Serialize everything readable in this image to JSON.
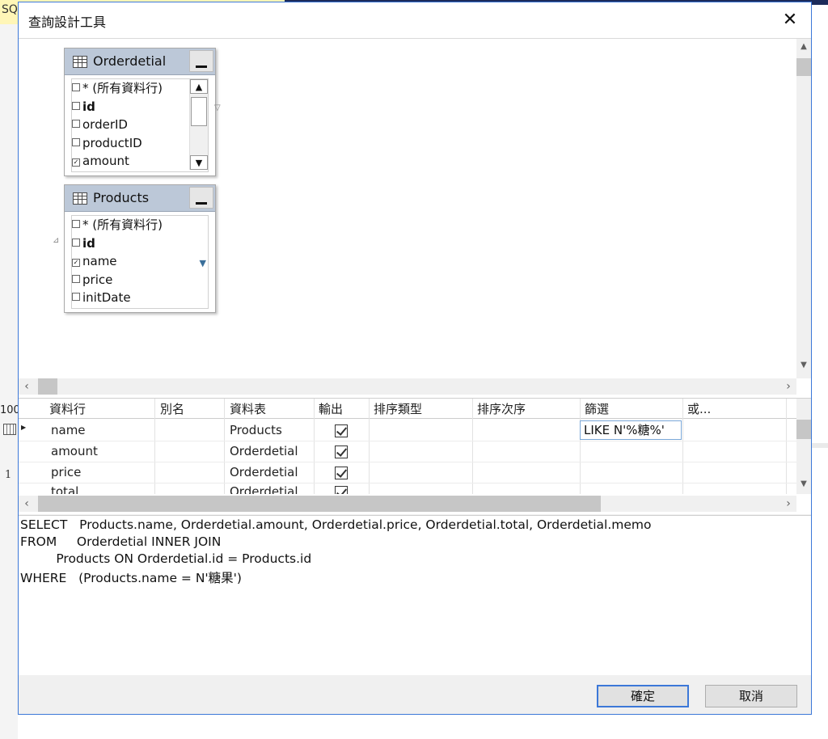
{
  "background": {
    "tab_fragment": "SQ",
    "zoom_fragment": "100",
    "line_number": "1"
  },
  "dialog": {
    "title": "查詢設計工具",
    "close_glyph": "✕"
  },
  "tables": [
    {
      "name": "Orderdetial",
      "columns": [
        {
          "label": "* (所有資料行)",
          "checked": false,
          "bold": false
        },
        {
          "label": "id",
          "checked": false,
          "bold": true
        },
        {
          "label": "orderID",
          "checked": false,
          "bold": false
        },
        {
          "label": "productID",
          "checked": false,
          "bold": false
        },
        {
          "label": "amount",
          "checked": true,
          "bold": false
        }
      ]
    },
    {
      "name": "Products",
      "columns": [
        {
          "label": "* (所有資料行)",
          "checked": false,
          "bold": false
        },
        {
          "label": "id",
          "checked": false,
          "bold": true
        },
        {
          "label": "name",
          "checked": true,
          "bold": false
        },
        {
          "label": "price",
          "checked": false,
          "bold": false
        },
        {
          "label": "initDate",
          "checked": false,
          "bold": false
        }
      ]
    }
  ],
  "grid": {
    "headers": [
      "資料行",
      "別名",
      "資料表",
      "輸出",
      "排序類型",
      "排序次序",
      "篩選",
      "或..."
    ],
    "rows": [
      {
        "column": "name",
        "alias": "",
        "table": "Products",
        "output": true,
        "filter": "LIKE N'%糖%'"
      },
      {
        "column": "amount",
        "alias": "",
        "table": "Orderdetial",
        "output": true,
        "filter": ""
      },
      {
        "column": "price",
        "alias": "",
        "table": "Orderdetial",
        "output": true,
        "filter": ""
      },
      {
        "column": "total",
        "alias": "",
        "table": "Orderdetial",
        "output": true,
        "filter": ""
      }
    ]
  },
  "sql": {
    "line1": "SELECT   Products.name, Orderdetial.amount, Orderdetial.price, Orderdetial.total, Orderdetial.memo",
    "line2": "FROM     Orderdetial INNER JOIN",
    "line3": "         Products ON Orderdetial.id = Products.id",
    "line4": "WHERE   (Products.name = N'糖果')"
  },
  "buttons": {
    "ok": "確定",
    "cancel": "取消"
  },
  "colors": {
    "accent": "#3c78d8",
    "table_header": "#bcc8d8"
  }
}
